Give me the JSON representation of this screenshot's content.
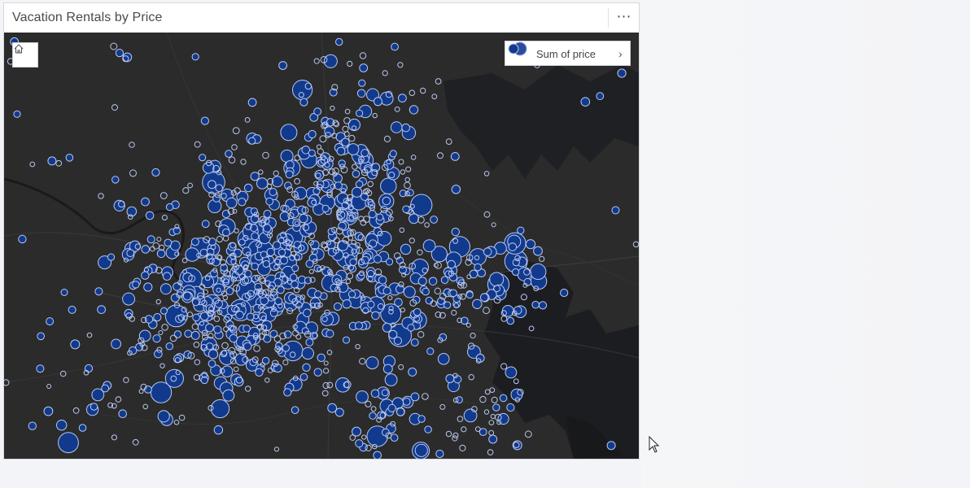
{
  "card": {
    "title": "Vacation Rentals by Price",
    "more_label": "⋯"
  },
  "map": {
    "basemap": "dark-gray-canvas",
    "home_icon": "home-icon",
    "symbol_color": "#123a8c",
    "symbol_stroke": "#b9c8f0",
    "water_color": "#1a1c1f",
    "land_color": "#2b2b2b"
  },
  "legend": {
    "label": "Sum of price",
    "chevron": "›"
  }
}
